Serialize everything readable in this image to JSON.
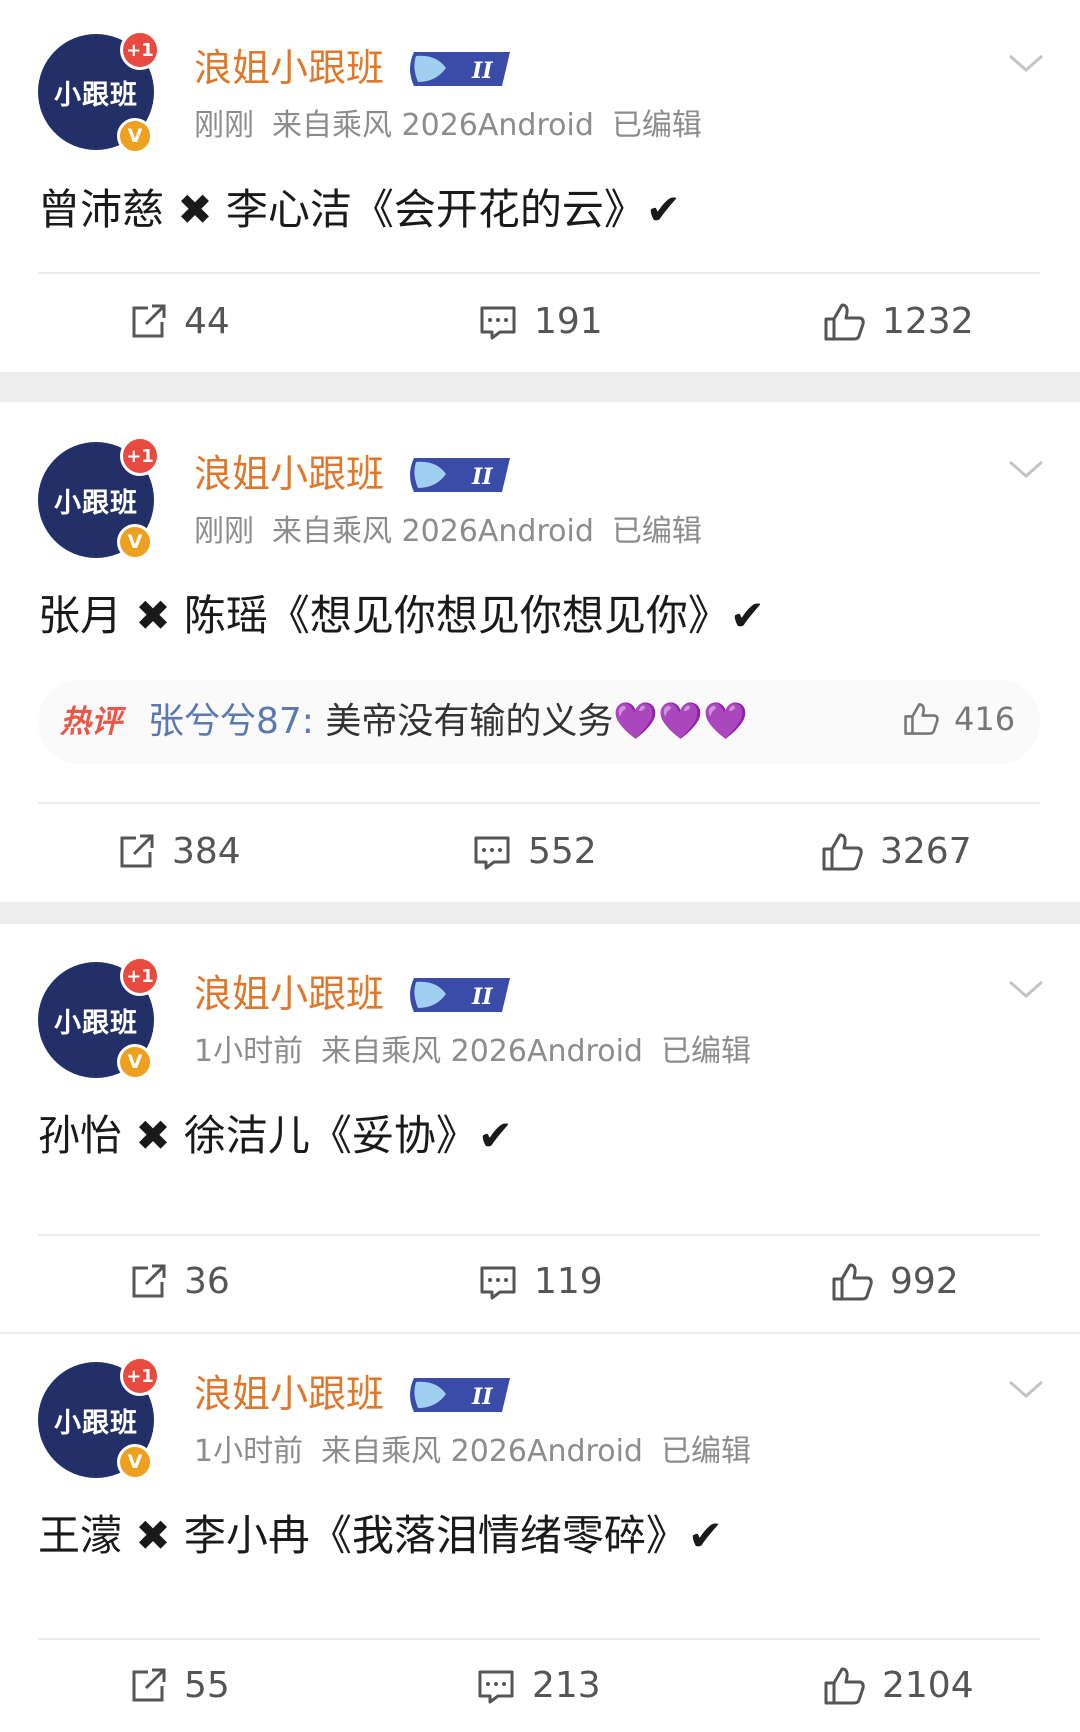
{
  "posts": [
    {
      "author": "浪姐小跟班",
      "avatar_text": "小跟班",
      "badge_plus": "+1",
      "badge_v": "V",
      "time": "刚刚",
      "source": "来自乘风 2026Android",
      "edited": "已编辑",
      "content": "曾沛慈 ✖ 李心洁《会开花的云》✔",
      "reposts": "44",
      "comments": "191",
      "likes": "1232"
    },
    {
      "author": "浪姐小跟班",
      "avatar_text": "小跟班",
      "badge_plus": "+1",
      "badge_v": "V",
      "time": "刚刚",
      "source": "来自乘风 2026Android",
      "edited": "已编辑",
      "content": "张月 ✖ 陈瑶《想见你想见你想见你》✔",
      "hot_comment": {
        "label": "热评",
        "user": "张兮兮87:",
        "text": " 美帝没有输的义务💜💜💜",
        "likes": "416"
      },
      "reposts": "384",
      "comments": "552",
      "likes": "3267"
    },
    {
      "author": "浪姐小跟班",
      "avatar_text": "小跟班",
      "badge_plus": "+1",
      "badge_v": "V",
      "time": "1小时前",
      "source": "来自乘风 2026Android",
      "edited": "已编辑",
      "content": "孙怡 ✖ 徐洁儿《妥协》✔",
      "reposts": "36",
      "comments": "119",
      "likes": "992"
    },
    {
      "author": "浪姐小跟班",
      "avatar_text": "小跟班",
      "badge_plus": "+1",
      "badge_v": "V",
      "time": "1小时前",
      "source": "来自乘风 2026Android",
      "edited": "已编辑",
      "content": "王濛 ✖ 李小冉《我落泪情绪零碎》✔",
      "reposts": "55",
      "comments": "213",
      "likes": "2104"
    }
  ],
  "icons": {
    "repost": "repost-icon",
    "comment": "comment-icon",
    "like": "like-icon",
    "chevron": "chevron-down-icon",
    "level": "whale-level-icon"
  },
  "colors": {
    "author": "#e0782b",
    "meta": "#8c8c8c",
    "avatar_bg": "#223067",
    "hot_label": "#e8584a",
    "hot_user": "#5b78b0",
    "separator": "#ededed"
  }
}
